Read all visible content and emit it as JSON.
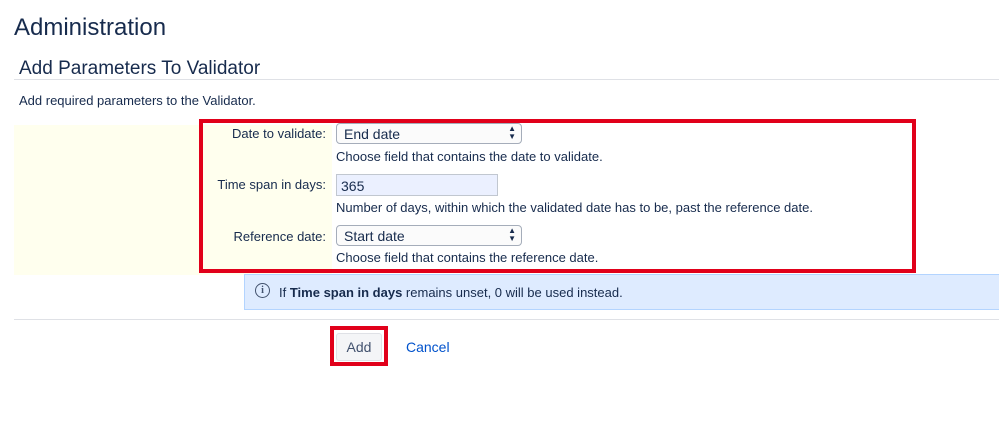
{
  "page": {
    "title": "Administration"
  },
  "section": {
    "title": "Add Parameters To Validator",
    "description": "Add required parameters to the Validator."
  },
  "form": {
    "date_to_validate": {
      "label": "Date to validate:",
      "selected": "End date",
      "help": "Choose field that contains the date to validate."
    },
    "time_span": {
      "label": "Time span in days:",
      "value": "365",
      "help": "Number of days, within which the validated date has to be, past the reference date."
    },
    "reference_date": {
      "label": "Reference date:",
      "selected": "Start date",
      "help": "Choose field that contains the reference date."
    }
  },
  "info": {
    "icon": "info-icon",
    "prefix": "If ",
    "bold": "Time span in days",
    "suffix": " remains unset, 0 will be used instead."
  },
  "actions": {
    "add_label": "Add",
    "cancel_label": "Cancel"
  },
  "colors": {
    "highlight": "#e1001a",
    "form_panel": "#ffffee",
    "info_background": "#deebff",
    "link": "#0052cc"
  }
}
